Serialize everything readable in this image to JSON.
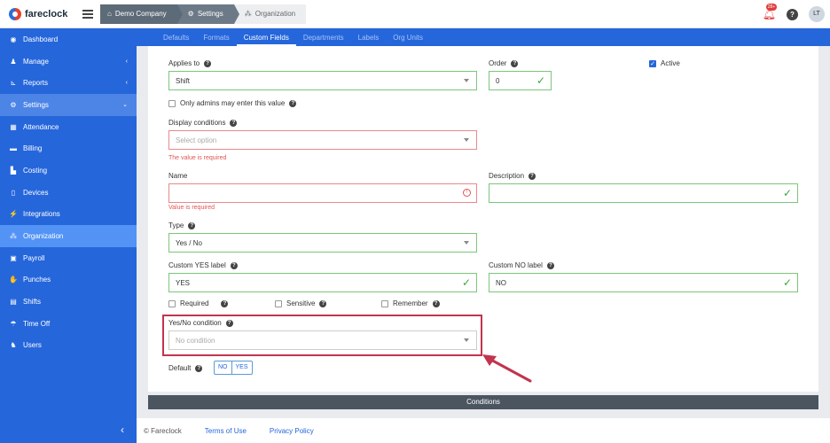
{
  "app": {
    "name": "fareclock"
  },
  "breadcrumbs": [
    "Demo Company",
    "Settings",
    "Organization"
  ],
  "header": {
    "notifications": "28+",
    "help": "?",
    "user_initials": "LT"
  },
  "sidebar": {
    "items": [
      {
        "label": "Dashboard",
        "icon": "dashboard-icon"
      },
      {
        "label": "Manage",
        "icon": "user-icon",
        "chevron": "‹"
      },
      {
        "label": "Reports",
        "icon": "chart-icon",
        "chevron": "‹"
      },
      {
        "label": "Settings",
        "icon": "gear-icon",
        "chevron": "⌄"
      },
      {
        "label": "Attendance",
        "icon": "attendance-icon"
      },
      {
        "label": "Billing",
        "icon": "card-icon"
      },
      {
        "label": "Costing",
        "icon": "costing-icon"
      },
      {
        "label": "Devices",
        "icon": "device-icon"
      },
      {
        "label": "Integrations",
        "icon": "plug-icon"
      },
      {
        "label": "Organization",
        "icon": "org-icon"
      },
      {
        "label": "Payroll",
        "icon": "money-icon"
      },
      {
        "label": "Punches",
        "icon": "punch-icon"
      },
      {
        "label": "Shifts",
        "icon": "calendar-icon"
      },
      {
        "label": "Time Off",
        "icon": "umbrella-icon"
      },
      {
        "label": "Users",
        "icon": "users-icon"
      }
    ],
    "collapse": "‹"
  },
  "tabs": [
    "Defaults",
    "Formats",
    "Custom Fields",
    "Departments",
    "Labels",
    "Org Units"
  ],
  "form": {
    "applies_to": {
      "label": "Applies to",
      "value": "Shift"
    },
    "order": {
      "label": "Order",
      "value": "0"
    },
    "active": {
      "label": "Active",
      "checked": true
    },
    "only_admins": {
      "label": "Only admins may enter this value"
    },
    "display_conditions": {
      "label": "Display conditions",
      "placeholder": "Select option",
      "error": "The value is required"
    },
    "name": {
      "label": "Name",
      "error": "Value is required"
    },
    "description": {
      "label": "Description"
    },
    "type": {
      "label": "Type",
      "value": "Yes / No"
    },
    "custom_yes": {
      "label": "Custom YES label",
      "value": "YES"
    },
    "custom_no": {
      "label": "Custom NO label",
      "value": "NO"
    },
    "required": {
      "label": "Required"
    },
    "sensitive": {
      "label": "Sensitive"
    },
    "remember": {
      "label": "Remember"
    },
    "yes_no_condition": {
      "label": "Yes/No condition",
      "placeholder": "No condition"
    },
    "default": {
      "label": "Default",
      "no": "NO",
      "yes": "YES"
    }
  },
  "conditions_bar": "Conditions",
  "footer": {
    "copyright": "© Fareclock",
    "terms": "Terms of Use",
    "privacy": "Privacy Policy"
  },
  "colors": {
    "primary": "#2566db",
    "success": "#3aa83a",
    "error": "#e05555",
    "highlight": "#c2344f"
  }
}
